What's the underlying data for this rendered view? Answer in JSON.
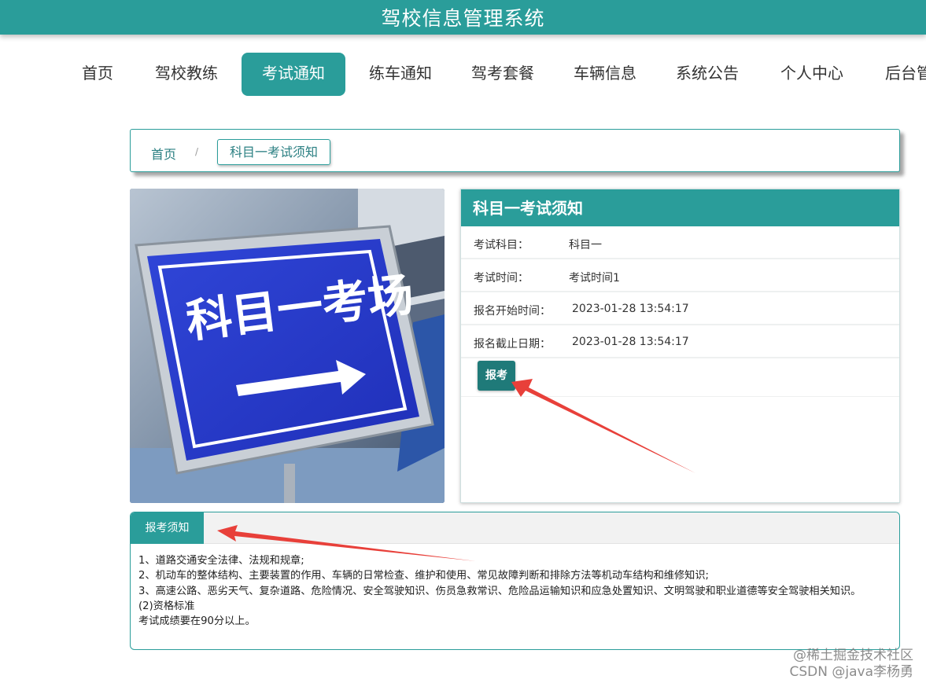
{
  "header": {
    "title": "驾校信息管理系统"
  },
  "nav": {
    "items": [
      "首页",
      "驾校教练",
      "考试通知",
      "练车通知",
      "驾考套餐",
      "车辆信息",
      "系统公告",
      "个人中心",
      "后台管理"
    ]
  },
  "breadcrumb": {
    "home": "首页",
    "separator": "/",
    "current": "科目一考试须知"
  },
  "photo": {
    "sign_text": "科目一考场"
  },
  "detail": {
    "title": "科目一考试须知",
    "rows": [
      {
        "label": "考试科目：",
        "value": "科目一"
      },
      {
        "label": "考试时间：",
        "value": "考试时间1"
      },
      {
        "label": "报名开始时间：",
        "value": "2023-01-28 13:54:17"
      },
      {
        "label": "报名截止日期：",
        "value": "2023-01-28 13:54:17"
      }
    ],
    "register_button": "报考"
  },
  "notice": {
    "tab": "报考须知",
    "lines": [
      "1、道路交通安全法律、法规和规章;",
      "2、机动车的整体结构、主要装置的作用、车辆的日常检查、维护和使用、常见故障判断和排除方法等机动车结构和维修知识;",
      "3、高速公路、恶劣天气、复杂道路、危险情况、安全驾驶知识、伤员急救常识、危险品运输知识和应急处置知识、文明驾驶和职业道德等安全驾驶相关知识。",
      "(2)资格标准",
      "考试成绩要在90分以上。"
    ]
  },
  "watermark": {
    "line1": "@稀土掘金技术社区",
    "line2": "CSDN @java李杨勇"
  },
  "colors": {
    "primary": "#2a9d9a",
    "button": "#1f7a79",
    "annotation_arrow": "#e8403a"
  }
}
